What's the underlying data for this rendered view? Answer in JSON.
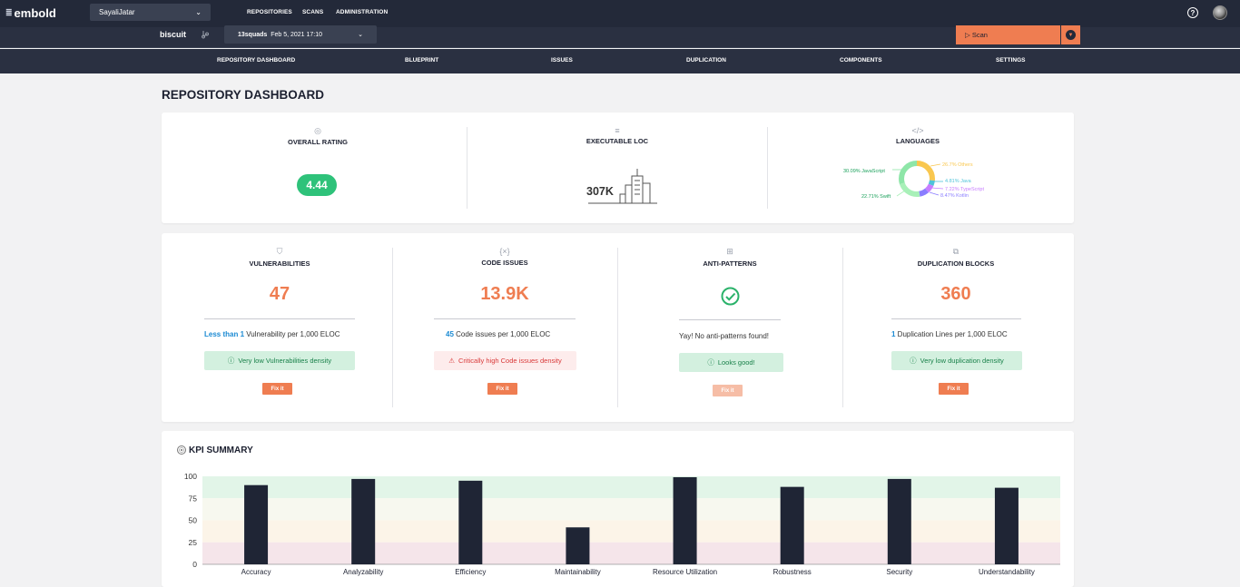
{
  "app": {
    "logo": "embold"
  },
  "topbar": {
    "user": "SayaliJatar",
    "nav": [
      "REPOSITORIES",
      "SCANS",
      "ADMINISTRATION"
    ]
  },
  "subbar": {
    "repo": "biscuit",
    "scan_project": "13squads",
    "scan_date": "Feb 5, 2021 17:10",
    "scan_button": "Scan"
  },
  "tabs": [
    "REPOSITORY DASHBOARD",
    "BLUEPRINT",
    "ISSUES",
    "DUPLICATION",
    "COMPONENTS",
    "SETTINGS"
  ],
  "page_title": "REPOSITORY DASHBOARD",
  "overview": {
    "rating": {
      "title": "OVERALL RATING",
      "value": "4.44"
    },
    "loc": {
      "title": "EXECUTABLE LOC",
      "value": "307K"
    },
    "languages": {
      "title": "LANGUAGES",
      "items": [
        {
          "label": "30.09% JavaScript",
          "percent": 30.09,
          "color": "#8ee6a8"
        },
        {
          "label": "26.7% Others",
          "percent": 26.7,
          "color": "#f9c74f"
        },
        {
          "label": "4.81% Java",
          "percent": 4.81,
          "color": "#4fc3d9"
        },
        {
          "label": "7.22% TypeScript",
          "percent": 7.22,
          "color": "#c77dff"
        },
        {
          "label": "8.47% Kotlin",
          "percent": 8.47,
          "color": "#8a7dff"
        },
        {
          "label": "22.71% Swift",
          "percent": 22.71,
          "color": "#a8f0b8"
        }
      ]
    }
  },
  "metrics": [
    {
      "title": "VULNERABILITIES",
      "value": "47",
      "density_value": "Less than 1",
      "density_text": " Vulnerability per 1,000 ELOC",
      "badge": "Very low Vulnerabilities density",
      "badge_type": "good",
      "fix": "Fix it"
    },
    {
      "title": "CODE ISSUES",
      "value": "13.9K",
      "density_value": "45",
      "density_text": " Code issues per 1,000 ELOC",
      "badge": "Critically high Code issues density",
      "badge_type": "bad",
      "fix": "Fix it"
    },
    {
      "title": "ANTI-PATTERNS",
      "value": "",
      "density_value": "",
      "density_text": "Yay! No anti-patterns found!",
      "badge": "Looks good!",
      "badge_type": "good",
      "fix": "Fix it"
    },
    {
      "title": "DUPLICATION BLOCKS",
      "value": "360",
      "density_value": "1",
      "density_text": " Duplication Lines per 1,000 ELOC",
      "badge": "Very low duplication density",
      "badge_type": "good",
      "fix": "Fix it"
    }
  ],
  "kpi": {
    "title": "KPI SUMMARY"
  },
  "chart_data": {
    "type": "bar",
    "categories": [
      "Accuracy",
      "Analyzability",
      "Efficiency",
      "Maintainability",
      "Resource Utilization",
      "Robustness",
      "Security",
      "Understandability"
    ],
    "values": [
      90,
      97,
      95,
      42,
      99,
      88,
      97,
      87
    ],
    "ylim": [
      0,
      100
    ],
    "yticks": [
      100,
      75,
      50,
      25,
      0
    ],
    "bands": [
      {
        "from": 75,
        "to": 100,
        "color": "#e2f5e8"
      },
      {
        "from": 50,
        "to": 75,
        "color": "#f7f8ef"
      },
      {
        "from": 25,
        "to": 50,
        "color": "#fcf4e8"
      },
      {
        "from": 0,
        "to": 25,
        "color": "#f5e5ea"
      }
    ],
    "bar_color": "#1f2535"
  }
}
